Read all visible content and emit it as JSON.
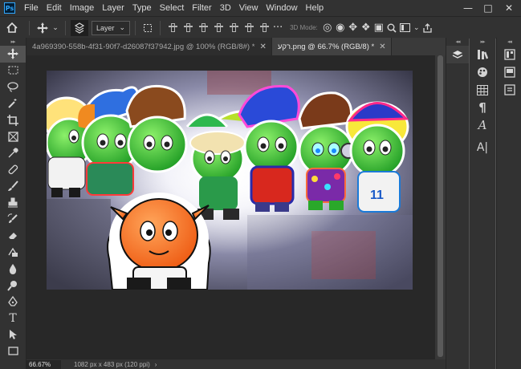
{
  "app": {
    "logo_text": "Ps"
  },
  "menu": [
    "File",
    "Edit",
    "Image",
    "Layer",
    "Type",
    "Select",
    "Filter",
    "3D",
    "View",
    "Window",
    "Help"
  ],
  "window_controls": {
    "minimize": "—",
    "maximize": "□",
    "close": "✕"
  },
  "options_bar": {
    "auto_select_value": "Layer",
    "mode_3d_label": "3D Mode:"
  },
  "tabs": [
    {
      "label": "4a969390-558b-4f31-90f7-d26087f37942.jpg @ 100% (RGB/8#) *",
      "active": false
    },
    {
      "label": "רקע.png @ 66.7% (RGB/8) *",
      "active": true
    }
  ],
  "status": {
    "zoom": "66.67%",
    "doc_info": "1082 px x 483 px (120 ppi)"
  },
  "tools": [
    "move-icon",
    "marquee-icon",
    "lasso-icon",
    "magic-wand-icon",
    "crop-icon",
    "frame-icon",
    "eyedropper-icon",
    "healing-brush-icon",
    "brush-icon",
    "clone-stamp-icon",
    "history-brush-icon",
    "eraser-icon",
    "gradient-icon",
    "blur-icon",
    "dodge-icon",
    "pen-icon",
    "type-icon",
    "path-selection-icon",
    "shape-icon"
  ],
  "panels": {
    "col1": [
      "layers-icon"
    ],
    "col2": [
      "libraries-icon",
      "color-icon",
      "swatches-icon",
      "paragraph-icon",
      "character-icon",
      "character-styles-icon"
    ],
    "col3": [
      "properties-icon",
      "learn-icon",
      "adjustments-icon"
    ]
  },
  "colors": {
    "chrome": "#323232",
    "canvas_bg": "#282828",
    "accent": "#31a8ff"
  }
}
